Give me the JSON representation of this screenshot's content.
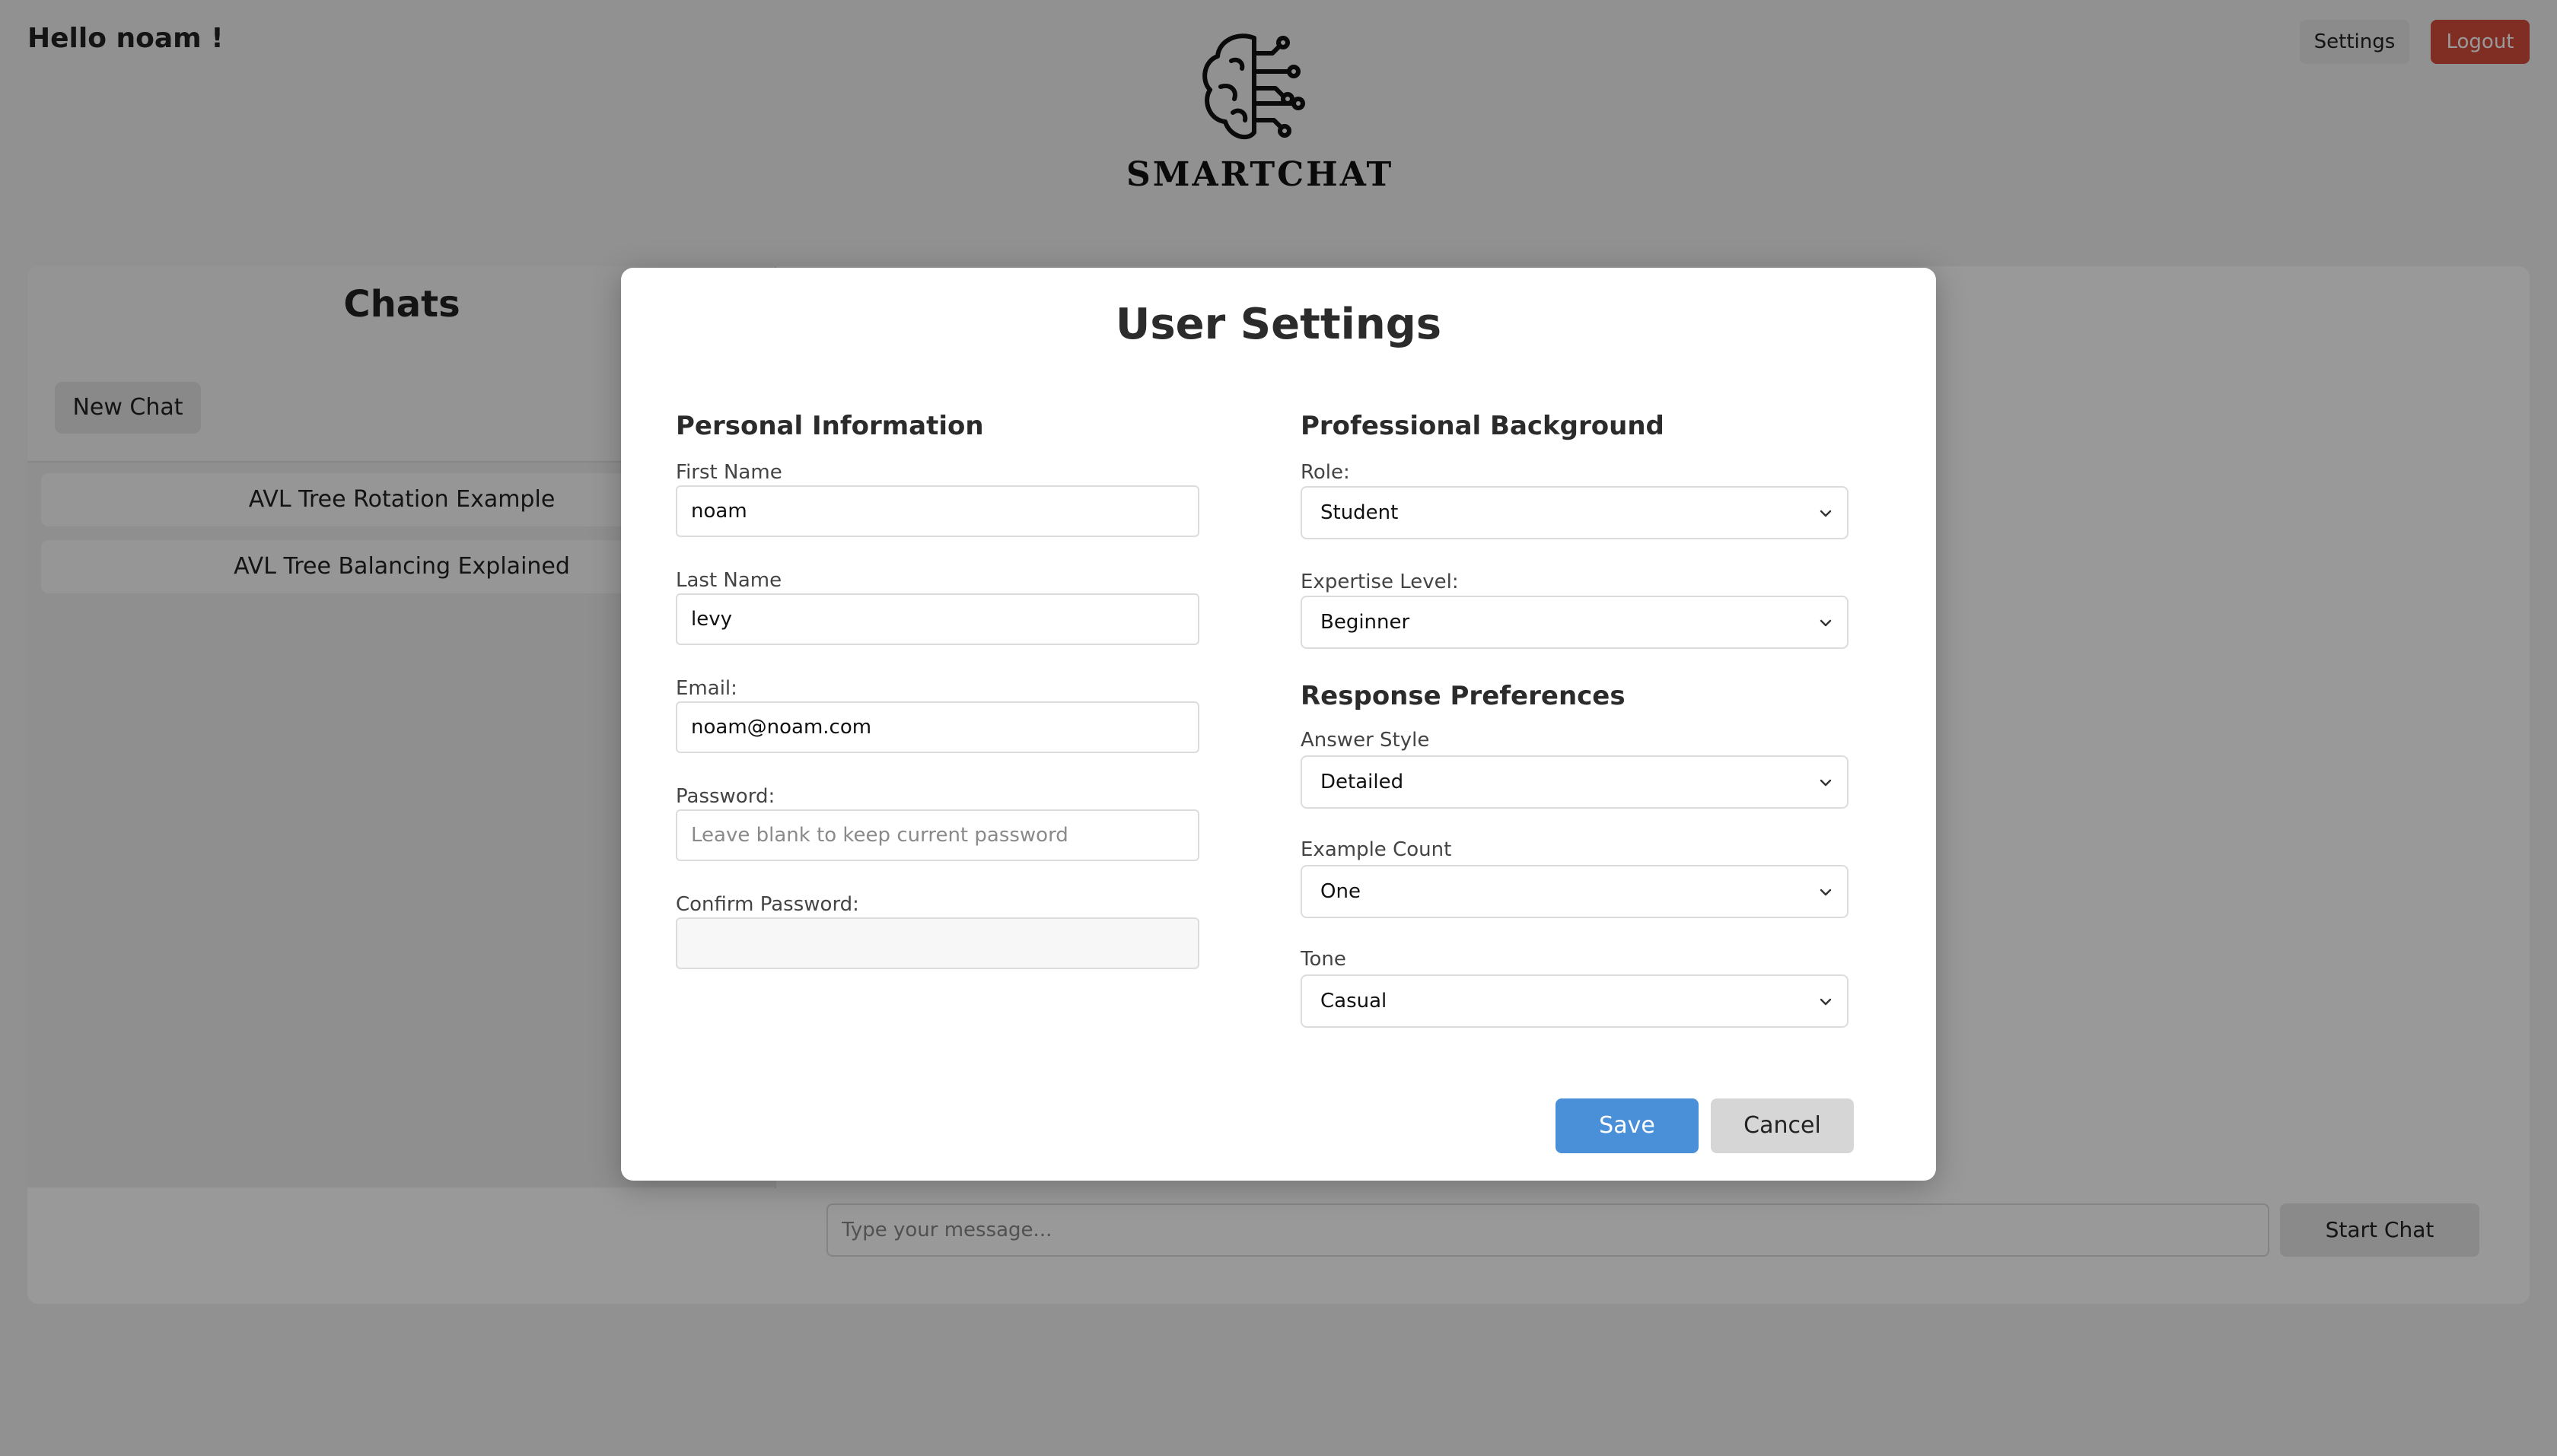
{
  "header": {
    "greeting": "Hello noam !",
    "logo_text": "SMARTCHAT",
    "settings_label": "Settings",
    "logout_label": "Logout"
  },
  "sidebar": {
    "title": "Chats",
    "new_chat_label": "New Chat",
    "chats": [
      {
        "title": "AVL Tree Rotation Example"
      },
      {
        "title": "AVL Tree Balancing Explained"
      }
    ]
  },
  "composer": {
    "placeholder": "Type your message...",
    "start_label": "Start Chat"
  },
  "modal": {
    "title": "User Settings",
    "personal": {
      "heading": "Personal Information",
      "first_name_label": "First Name",
      "first_name_value": "noam",
      "last_name_label": "Last Name",
      "last_name_value": "levy",
      "email_label": "Email:",
      "email_value": "noam@noam.com",
      "password_label": "Password:",
      "password_placeholder": "Leave blank to keep current password",
      "confirm_label": "Confirm Password:"
    },
    "professional": {
      "heading": "Professional Background",
      "role_label": "Role:",
      "role_value": "Student",
      "expertise_label": "Expertise Level:",
      "expertise_value": "Beginner"
    },
    "preferences": {
      "heading": "Response Preferences",
      "style_label": "Answer Style",
      "style_value": "Detailed",
      "count_label": "Example Count",
      "count_value": "One",
      "tone_label": "Tone",
      "tone_value": "Casual"
    },
    "save_label": "Save",
    "cancel_label": "Cancel"
  },
  "colors": {
    "save": "#4a90d9",
    "logout": "#d64b3d",
    "overlay": "rgba(0,0,0,0.4)"
  }
}
